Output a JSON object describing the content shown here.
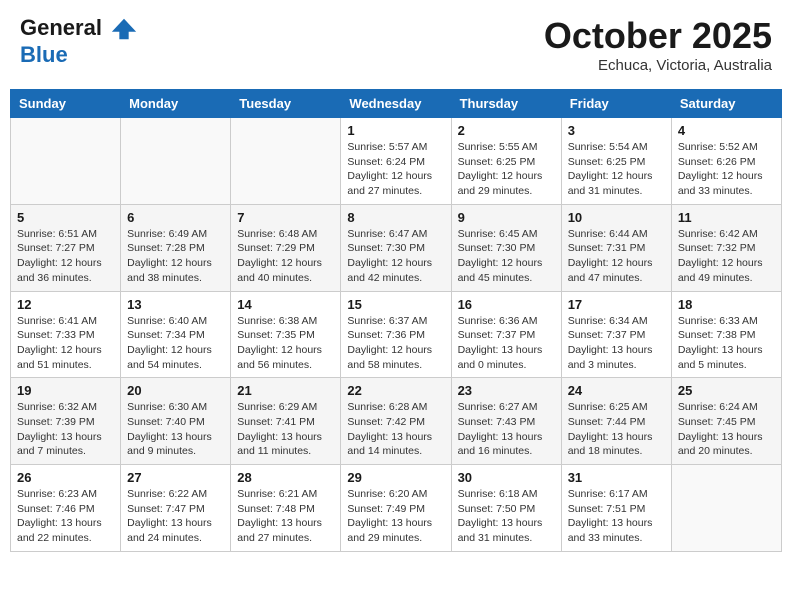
{
  "header": {
    "logo_line1": "General",
    "logo_line2": "Blue",
    "month_title": "October 2025",
    "subtitle": "Echuca, Victoria, Australia"
  },
  "weekdays": [
    "Sunday",
    "Monday",
    "Tuesday",
    "Wednesday",
    "Thursday",
    "Friday",
    "Saturday"
  ],
  "weeks": [
    [
      {
        "day": "",
        "info": ""
      },
      {
        "day": "",
        "info": ""
      },
      {
        "day": "",
        "info": ""
      },
      {
        "day": "1",
        "info": "Sunrise: 5:57 AM\nSunset: 6:24 PM\nDaylight: 12 hours\nand 27 minutes."
      },
      {
        "day": "2",
        "info": "Sunrise: 5:55 AM\nSunset: 6:25 PM\nDaylight: 12 hours\nand 29 minutes."
      },
      {
        "day": "3",
        "info": "Sunrise: 5:54 AM\nSunset: 6:25 PM\nDaylight: 12 hours\nand 31 minutes."
      },
      {
        "day": "4",
        "info": "Sunrise: 5:52 AM\nSunset: 6:26 PM\nDaylight: 12 hours\nand 33 minutes."
      }
    ],
    [
      {
        "day": "5",
        "info": "Sunrise: 6:51 AM\nSunset: 7:27 PM\nDaylight: 12 hours\nand 36 minutes."
      },
      {
        "day": "6",
        "info": "Sunrise: 6:49 AM\nSunset: 7:28 PM\nDaylight: 12 hours\nand 38 minutes."
      },
      {
        "day": "7",
        "info": "Sunrise: 6:48 AM\nSunset: 7:29 PM\nDaylight: 12 hours\nand 40 minutes."
      },
      {
        "day": "8",
        "info": "Sunrise: 6:47 AM\nSunset: 7:30 PM\nDaylight: 12 hours\nand 42 minutes."
      },
      {
        "day": "9",
        "info": "Sunrise: 6:45 AM\nSunset: 7:30 PM\nDaylight: 12 hours\nand 45 minutes."
      },
      {
        "day": "10",
        "info": "Sunrise: 6:44 AM\nSunset: 7:31 PM\nDaylight: 12 hours\nand 47 minutes."
      },
      {
        "day": "11",
        "info": "Sunrise: 6:42 AM\nSunset: 7:32 PM\nDaylight: 12 hours\nand 49 minutes."
      }
    ],
    [
      {
        "day": "12",
        "info": "Sunrise: 6:41 AM\nSunset: 7:33 PM\nDaylight: 12 hours\nand 51 minutes."
      },
      {
        "day": "13",
        "info": "Sunrise: 6:40 AM\nSunset: 7:34 PM\nDaylight: 12 hours\nand 54 minutes."
      },
      {
        "day": "14",
        "info": "Sunrise: 6:38 AM\nSunset: 7:35 PM\nDaylight: 12 hours\nand 56 minutes."
      },
      {
        "day": "15",
        "info": "Sunrise: 6:37 AM\nSunset: 7:36 PM\nDaylight: 12 hours\nand 58 minutes."
      },
      {
        "day": "16",
        "info": "Sunrise: 6:36 AM\nSunset: 7:37 PM\nDaylight: 13 hours\nand 0 minutes."
      },
      {
        "day": "17",
        "info": "Sunrise: 6:34 AM\nSunset: 7:37 PM\nDaylight: 13 hours\nand 3 minutes."
      },
      {
        "day": "18",
        "info": "Sunrise: 6:33 AM\nSunset: 7:38 PM\nDaylight: 13 hours\nand 5 minutes."
      }
    ],
    [
      {
        "day": "19",
        "info": "Sunrise: 6:32 AM\nSunset: 7:39 PM\nDaylight: 13 hours\nand 7 minutes."
      },
      {
        "day": "20",
        "info": "Sunrise: 6:30 AM\nSunset: 7:40 PM\nDaylight: 13 hours\nand 9 minutes."
      },
      {
        "day": "21",
        "info": "Sunrise: 6:29 AM\nSunset: 7:41 PM\nDaylight: 13 hours\nand 11 minutes."
      },
      {
        "day": "22",
        "info": "Sunrise: 6:28 AM\nSunset: 7:42 PM\nDaylight: 13 hours\nand 14 minutes."
      },
      {
        "day": "23",
        "info": "Sunrise: 6:27 AM\nSunset: 7:43 PM\nDaylight: 13 hours\nand 16 minutes."
      },
      {
        "day": "24",
        "info": "Sunrise: 6:25 AM\nSunset: 7:44 PM\nDaylight: 13 hours\nand 18 minutes."
      },
      {
        "day": "25",
        "info": "Sunrise: 6:24 AM\nSunset: 7:45 PM\nDaylight: 13 hours\nand 20 minutes."
      }
    ],
    [
      {
        "day": "26",
        "info": "Sunrise: 6:23 AM\nSunset: 7:46 PM\nDaylight: 13 hours\nand 22 minutes."
      },
      {
        "day": "27",
        "info": "Sunrise: 6:22 AM\nSunset: 7:47 PM\nDaylight: 13 hours\nand 24 minutes."
      },
      {
        "day": "28",
        "info": "Sunrise: 6:21 AM\nSunset: 7:48 PM\nDaylight: 13 hours\nand 27 minutes."
      },
      {
        "day": "29",
        "info": "Sunrise: 6:20 AM\nSunset: 7:49 PM\nDaylight: 13 hours\nand 29 minutes."
      },
      {
        "day": "30",
        "info": "Sunrise: 6:18 AM\nSunset: 7:50 PM\nDaylight: 13 hours\nand 31 minutes."
      },
      {
        "day": "31",
        "info": "Sunrise: 6:17 AM\nSunset: 7:51 PM\nDaylight: 13 hours\nand 33 minutes."
      },
      {
        "day": "",
        "info": ""
      }
    ]
  ]
}
